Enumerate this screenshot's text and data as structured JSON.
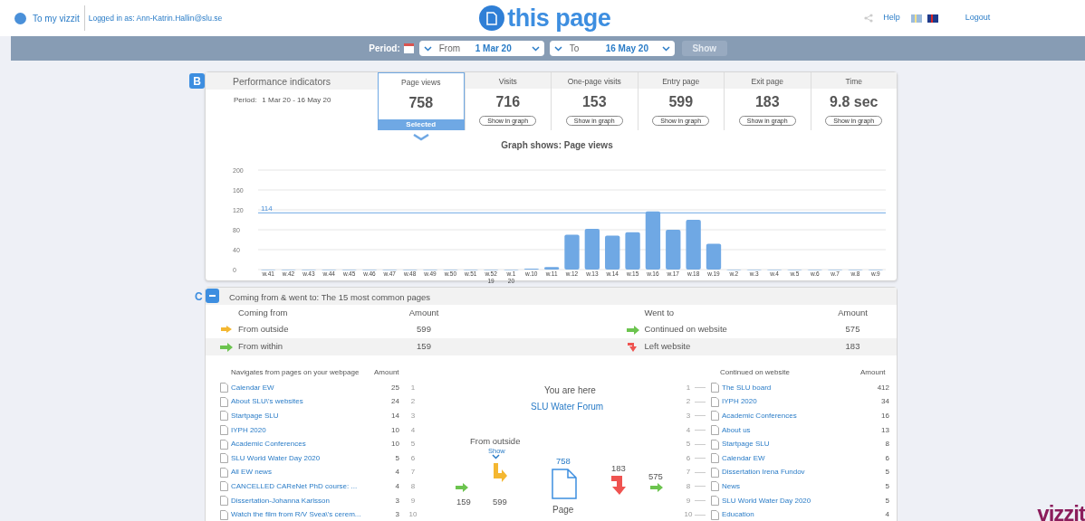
{
  "header": {
    "home_link": "To my vizzit",
    "logged_in": "Logged in as: Ann-Katrin.Hallin@slu.se",
    "title": "this page",
    "help": "Help",
    "languages": [
      {
        "kind": "swedish",
        "selected": false
      },
      {
        "kind": "english",
        "selected": true
      }
    ],
    "logout": "Logout"
  },
  "period_bar": {
    "label": "Period:",
    "from": {
      "label": "From",
      "value": "1 Mar 20"
    },
    "to": {
      "label": "To",
      "value": "16 May 20"
    },
    "show_button": {
      "label": "Show",
      "disabled": true
    }
  },
  "performance": {
    "badge": "B",
    "title": "Performance indicators",
    "period_label": "Period:",
    "period_value": "1 Mar 20 - 16 May 20",
    "indicators": [
      {
        "label": "Page views",
        "value": "758",
        "selected": true,
        "action": "Selected"
      },
      {
        "label": "Visits",
        "value": "716",
        "selected": false,
        "action": "Show in graph"
      },
      {
        "label": "One-page visits",
        "value": "153",
        "selected": false,
        "action": "Show in graph"
      },
      {
        "label": "Entry page",
        "value": "599",
        "selected": false,
        "action": "Show in graph"
      },
      {
        "label": "Exit page",
        "value": "183",
        "selected": false,
        "action": "Show in graph"
      },
      {
        "label": "Time",
        "value": "9.8 sec",
        "selected": false,
        "action": "Show in graph"
      }
    ],
    "chart_data": {
      "type": "bar",
      "title": "Graph shows: Page views",
      "categories": [
        "w.41",
        "w.42",
        "w.43",
        "w.44",
        "w.45",
        "w.46",
        "w.47",
        "w.48",
        "w.49",
        "w.50",
        "w.51",
        "w.52\n19",
        "w.1\n20",
        "w.10",
        "w.11",
        "w.12",
        "w.13",
        "w.14",
        "w.15",
        "w.16",
        "w.17",
        "w.18",
        "w.19",
        "w.2",
        "w.3",
        "w.4",
        "w.5",
        "w.6",
        "w.7",
        "w.8",
        "w.9"
      ],
      "series": [
        {
          "color": "#6fa8e4",
          "values": [
            0,
            0,
            0,
            0,
            0,
            0,
            0,
            0,
            0,
            0,
            0,
            0,
            0,
            2,
            5,
            70,
            82,
            68,
            75,
            117,
            80,
            100,
            52,
            0,
            0,
            0,
            0,
            0,
            0,
            0,
            0
          ]
        }
      ],
      "ylim": [
        0,
        200
      ],
      "yticks": [
        0,
        40,
        80,
        120,
        160,
        200
      ],
      "grid": true,
      "ref_lines": [
        {
          "axis": "y",
          "value": 114,
          "label": "114",
          "color": "#6fa8e4"
        }
      ]
    }
  },
  "flow": {
    "badge": "C",
    "expanded": true,
    "title": "Coming from & went to: The 15 most common pages",
    "coming_from": {
      "heading": "Coming from",
      "amount_heading": "Amount",
      "rows": [
        {
          "kind": "outside",
          "label": "From outside",
          "amount": "599"
        },
        {
          "kind": "within",
          "label": "From within",
          "amount": "159"
        }
      ]
    },
    "went_to": {
      "heading": "Went to",
      "amount_heading": "Amount",
      "rows": [
        {
          "kind": "continued",
          "label": "Continued on website",
          "amount": "575"
        },
        {
          "kind": "left",
          "label": "Left website",
          "amount": "183"
        }
      ]
    },
    "navigates_from": {
      "heading": "Navigates from pages on your webpage",
      "amount_heading": "Amount",
      "rows": [
        {
          "label": "Calendar EW",
          "amount": "25",
          "rank": "1"
        },
        {
          "label": "About SLU\\'s websites",
          "amount": "24",
          "rank": "2"
        },
        {
          "label": "Startpage SLU",
          "amount": "14",
          "rank": "3"
        },
        {
          "label": "IYPH 2020",
          "amount": "10",
          "rank": "4"
        },
        {
          "label": "Academic Conferences",
          "amount": "10",
          "rank": "5"
        },
        {
          "label": "SLU World Water Day 2020",
          "amount": "5",
          "rank": "6"
        },
        {
          "label": "All EW news",
          "amount": "4",
          "rank": "7"
        },
        {
          "label": "CANCELLED CAReNet PhD course: ...",
          "amount": "4",
          "rank": "8"
        },
        {
          "label": "Dissertation-Johanna Karlsson",
          "amount": "3",
          "rank": "9"
        },
        {
          "label": "Watch the film from R/V Svea\\'s cerem...",
          "amount": "3",
          "rank": "10"
        }
      ]
    },
    "continued": {
      "heading": "Continued on website",
      "amount_heading": "Amount",
      "rows": [
        {
          "label": "The SLU board",
          "amount": "412",
          "rank": "1"
        },
        {
          "label": "IYPH 2020",
          "amount": "34",
          "rank": "2"
        },
        {
          "label": "Academic Conferences",
          "amount": "16",
          "rank": "3"
        },
        {
          "label": "About us",
          "amount": "13",
          "rank": "4"
        },
        {
          "label": "Startpage SLU",
          "amount": "8",
          "rank": "5"
        },
        {
          "label": "Calendar EW",
          "amount": "6",
          "rank": "6"
        },
        {
          "label": "Dissertation Irena Fundov",
          "amount": "5",
          "rank": "7"
        },
        {
          "label": "News",
          "amount": "5",
          "rank": "8"
        },
        {
          "label": "SLU World Water Day 2020",
          "amount": "5",
          "rank": "9"
        },
        {
          "label": "Education",
          "amount": "4",
          "rank": "10"
        }
      ]
    },
    "center": {
      "here_label": "You are here",
      "page": "SLU Water Forum",
      "outside_label": "From outside",
      "show": "Show",
      "within_count": "159",
      "outside_count": "599",
      "page_views": "758",
      "page_label": "Page",
      "left_count": "183",
      "continued_count": "575"
    }
  },
  "logo": "vizzit"
}
